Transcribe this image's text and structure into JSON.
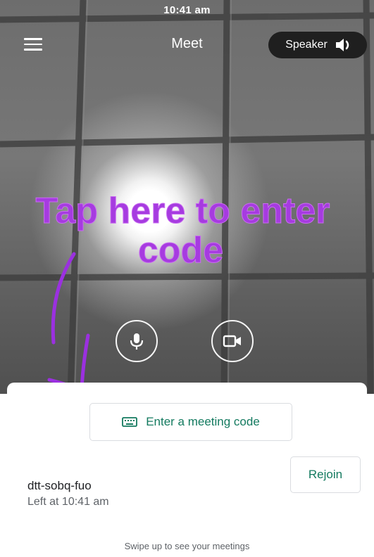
{
  "status_bar": {
    "time": "10:41 am"
  },
  "header": {
    "title": "Meet",
    "speaker_label": "Speaker",
    "menu_icon": "hamburger-menu-icon",
    "speaker_icon": "volume-icon"
  },
  "annotation": {
    "line1": "Tap here to enter",
    "line2": "code",
    "color": "#a63be0"
  },
  "controls": {
    "mic_icon": "microphone-icon",
    "camera_icon": "video-camera-icon"
  },
  "sheet": {
    "enter_code_label": "Enter a meeting code",
    "enter_code_icon": "keyboard-icon",
    "recent_meeting": {
      "code": "dtt-sobq-fuo",
      "time": "Left at 10:41 am",
      "rejoin_label": "Rejoin"
    },
    "swipe_hint": "Swipe up to see your meetings"
  },
  "colors": {
    "accent": "#137a5f",
    "annotation": "#a63be0",
    "speaker_pill": "#1f1f1f"
  }
}
